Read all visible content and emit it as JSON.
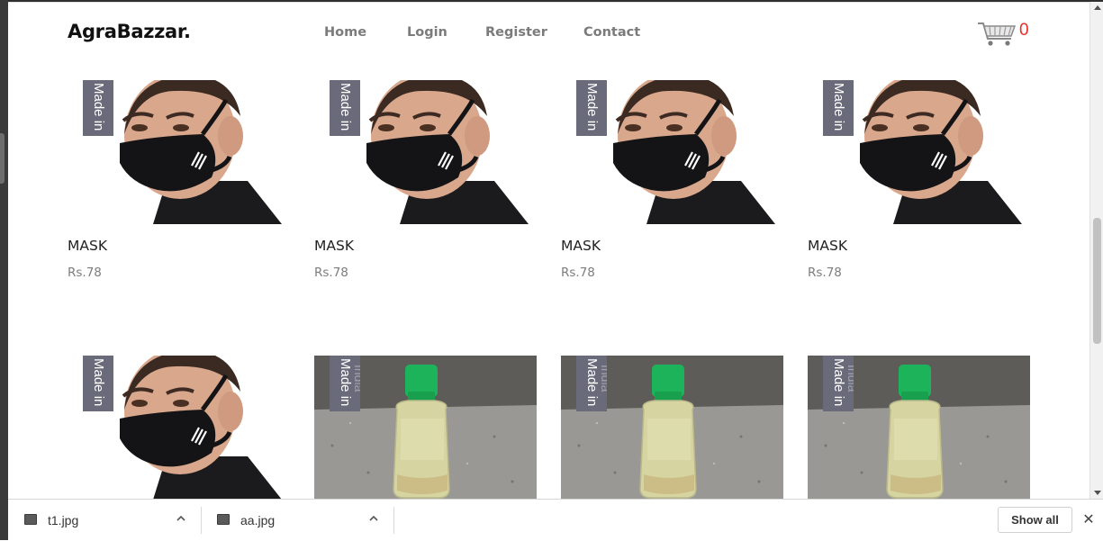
{
  "navbar": {
    "brand": "AgraBazzar.",
    "links": [
      "Home",
      "Login",
      "Register",
      "Contact"
    ],
    "cart_count": "0"
  },
  "products": [
    {
      "name": "MASK",
      "price": "Rs.78",
      "badge": "Made in",
      "badge_faint": "",
      "image": "mask"
    },
    {
      "name": "MASK",
      "price": "Rs.78",
      "badge": "Made in",
      "badge_faint": "",
      "image": "mask"
    },
    {
      "name": "MASK",
      "price": "Rs.78",
      "badge": "Made in",
      "badge_faint": "",
      "image": "mask"
    },
    {
      "name": "MASK",
      "price": "Rs.78",
      "badge": "Made in",
      "badge_faint": "",
      "image": "mask"
    },
    {
      "name": "",
      "price": "",
      "badge": "Made in",
      "badge_faint": "",
      "image": "mask"
    },
    {
      "name": "",
      "price": "",
      "badge": "Made in",
      "badge_faint": "India",
      "image": "sanitizer"
    },
    {
      "name": "",
      "price": "",
      "badge": "Made in",
      "badge_faint": "India",
      "image": "sanitizer"
    },
    {
      "name": "",
      "price": "",
      "badge": "Made in",
      "badge_faint": "India",
      "image": "sanitizer"
    }
  ],
  "downloads": {
    "items": [
      {
        "name": "t1.jpg",
        "icon": "image-file-icon"
      },
      {
        "name": "aa.jpg",
        "icon": "image-file-icon"
      }
    ],
    "show_all": "Show all",
    "close": "✕"
  },
  "colors": {
    "badge": "#6a6b7a",
    "cart_count": "#e2302a",
    "sanitizer_cap": "#1db35a"
  }
}
